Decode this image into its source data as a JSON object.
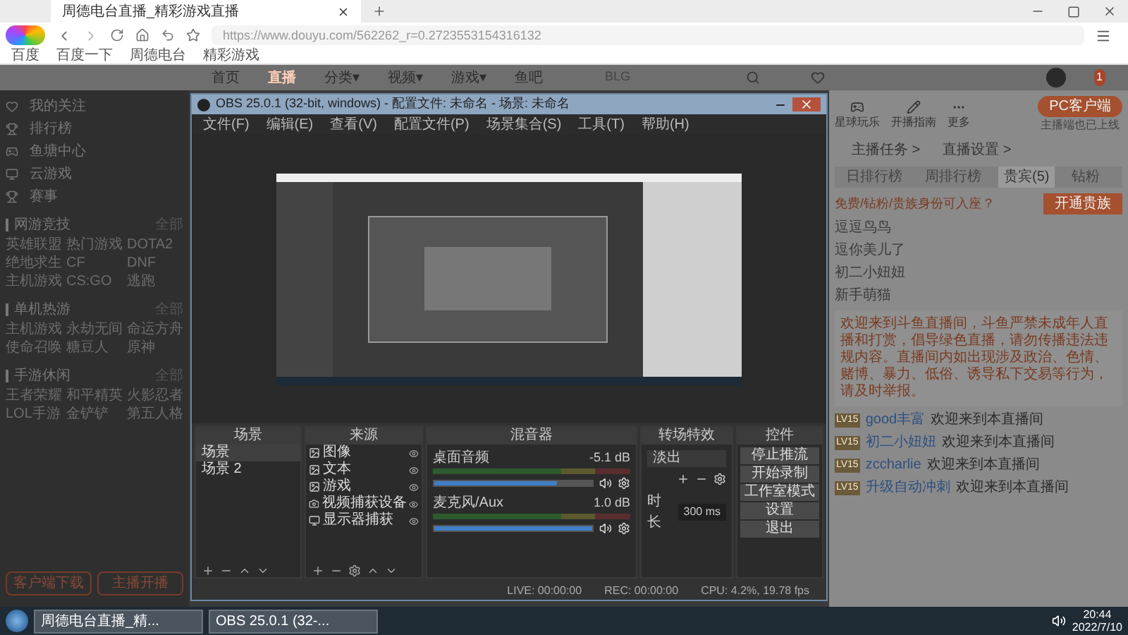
{
  "browser": {
    "tab": "周德电台直播_精彩游戏直播",
    "url": "https://www.douyu.com/562262_r=0.2723553154316132",
    "bookmarks": [
      "百度",
      "百度一下",
      "周德电台",
      "精彩游戏"
    ]
  },
  "nav": {
    "items": [
      {
        "label": "首页",
        "selected": false
      },
      {
        "label": "直播",
        "selected": true
      },
      {
        "label": "分类▾",
        "selected": false
      },
      {
        "label": "视频▾",
        "selected": false
      },
      {
        "label": "游戏▾",
        "selected": false
      },
      {
        "label": "鱼吧",
        "selected": false
      }
    ],
    "search": "BLG",
    "badge": "1"
  },
  "sidebar": {
    "links": [
      "我的关注",
      "排行榜",
      "鱼塘中心",
      "云游戏",
      "赛事"
    ],
    "sections": [
      {
        "title": "网游竞技",
        "more": "全部",
        "items": [
          "英雄联盟",
          "热门游戏",
          "DOTA2",
          "绝地求生",
          "CF",
          "DNF",
          "主机游戏",
          "CS:GO",
          "逃跑"
        ]
      },
      {
        "title": "单机热游",
        "more": "全部",
        "items": [
          "主机游戏",
          "永劫无间",
          "命运方舟",
          "使命召唤",
          "糖豆人",
          "原神"
        ]
      },
      {
        "title": "手游休闲",
        "more": "全部",
        "items": [
          "王者荣耀",
          "和平精英",
          "火影忍者",
          "LOL手游",
          "金铲铲",
          "第五人格"
        ]
      }
    ],
    "buttons": [
      "客户端下载",
      "主播开播"
    ]
  },
  "obs": {
    "title": "OBS 25.0.1 (32-bit, windows) - 配置文件: 未命名 - 场景: 未命名",
    "menu": [
      "文件(F)",
      "编辑(E)",
      "查看(V)",
      "配置文件(P)",
      "场景集合(S)",
      "工具(T)",
      "帮助(H)"
    ],
    "docks": [
      "场景",
      "来源",
      "混音器",
      "转场特效",
      "控件"
    ],
    "scenes": [
      {
        "name": "场景",
        "selected": true
      },
      {
        "name": "场景 2",
        "selected": false
      }
    ],
    "sources": [
      {
        "name": "图像",
        "kind": "image"
      },
      {
        "name": "文本",
        "kind": "image"
      },
      {
        "name": "游戏",
        "kind": "image"
      },
      {
        "name": "视频捕获设备",
        "kind": "camera"
      },
      {
        "name": "显示器捕获",
        "kind": "monitor"
      }
    ],
    "mixer": [
      {
        "name": "桌面音频",
        "reading": "-5.1 dB",
        "level": 0.78
      },
      {
        "name": "麦克风/Aux",
        "reading": "1.0 dB",
        "level": 1.0
      }
    ],
    "transition": {
      "value": "淡出",
      "label": "时长",
      "duration": "300 ms"
    },
    "controls": [
      "停止推流",
      "开始录制",
      "工作室模式",
      "设置",
      "退出"
    ],
    "status": [
      "LIVE: 00:00:00",
      "REC: 00:00:00",
      "CPU: 4.2%, 19.78 fps"
    ]
  },
  "right": {
    "tools": [
      "星球玩乐",
      "开播指南",
      "更多"
    ],
    "pc_button": "PC客户端",
    "pc_note": "主播端也已上线",
    "links": [
      "主播任务 >",
      "直播设置 >"
    ],
    "tabs": [
      {
        "label": "日排行榜",
        "selected": false
      },
      {
        "label": "周排行榜",
        "selected": false
      },
      {
        "label": "贵宾(5)",
        "selected": true
      },
      {
        "label": "钻粉",
        "selected": false
      }
    ],
    "seat_note": "免费/钻粉/贵族身份可入座 ?",
    "open_button": "开通贵族",
    "guests": [
      "逗逗鸟鸟",
      "逗你美儿了",
      "初二小妞妞",
      "新手萌猫"
    ],
    "notice": "欢迎来到斗鱼直播间，斗鱼严禁未成年人直播和打赏，倡导绿色直播，请勿传播违法违规内容。直播间内如出现涉及政治、色情、赌博、暴力、低俗、诱导私下交易等行为，请及时举报。",
    "chat": [
      {
        "level": "LV15",
        "user": "good丰富",
        "text": "欢迎来到本直播间"
      },
      {
        "level": "LV15",
        "user": "初二小妞妞",
        "text": "欢迎来到本直播间"
      },
      {
        "level": "LV15",
        "user": "zccharlie",
        "text": "欢迎来到本直播间"
      },
      {
        "level": "LV15",
        "user": "升级自动冲刺",
        "text": "欢迎来到本直播间"
      }
    ]
  },
  "taskbar": {
    "items": [
      "周德电台直播_精...",
      "OBS 25.0.1 (32-..."
    ],
    "time": "20:44",
    "date": "2022/7/10"
  }
}
